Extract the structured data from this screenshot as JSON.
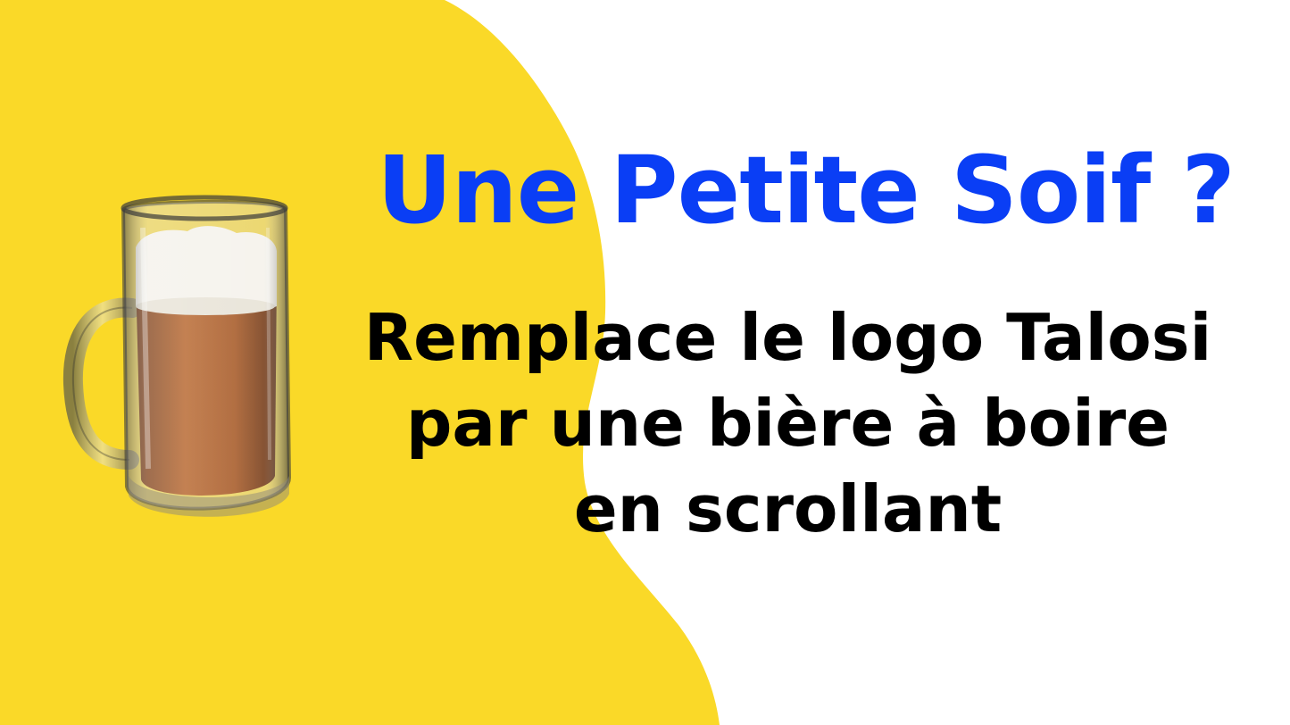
{
  "colors": {
    "background": "#ffffff",
    "accent_yellow": "#FAD928",
    "headline_blue": "#0A3EF5",
    "text_black": "#000000",
    "beer_amber": "#A8531B",
    "foam": "#F4F1EA"
  },
  "headline": "Une Petite Soif ?",
  "subtext": {
    "line1": "Remplace le logo Talosi",
    "line2": "par une bière à boire",
    "line3": "en scrollant"
  },
  "illustration": {
    "icon": "beer-mug-icon"
  }
}
